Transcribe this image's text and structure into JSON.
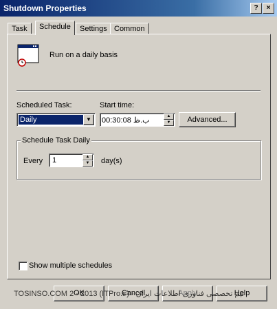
{
  "window": {
    "title": "Shutdown Properties",
    "help_glyph": "?",
    "close_glyph": "×"
  },
  "tabs": [
    "Task",
    "Schedule",
    "Settings",
    "Common"
  ],
  "active_tab": "Schedule",
  "summary": {
    "text": "Run on a daily basis"
  },
  "scheduled_task": {
    "label": "Scheduled Task:",
    "value": "Daily",
    "dropdown_glyph": "▼"
  },
  "start_time": {
    "label": "Start time:",
    "value": "ب.ظ 00:30:08"
  },
  "advanced_button": {
    "label": "Advanced..."
  },
  "group": {
    "title": "Schedule Task Daily",
    "every_label": "Every",
    "every_value": "1",
    "unit_label": "day(s)"
  },
  "show_multiple": {
    "label": "Show multiple schedules",
    "checked": false
  },
  "footer": {
    "overlay_text": "TOSINSO.COM 2 - 2013 (ITPro.ir) - تیم تخصصی فناوری اطلاعات ایران",
    "ok_label": "OK",
    "cancel_label": "Cancel",
    "apply_label": "Apply",
    "help_label": "Help"
  },
  "colors": {
    "face": "#d4d0c8",
    "title_start": "#0a246a",
    "title_end": "#a6caf0",
    "selection": "#0a246a"
  }
}
